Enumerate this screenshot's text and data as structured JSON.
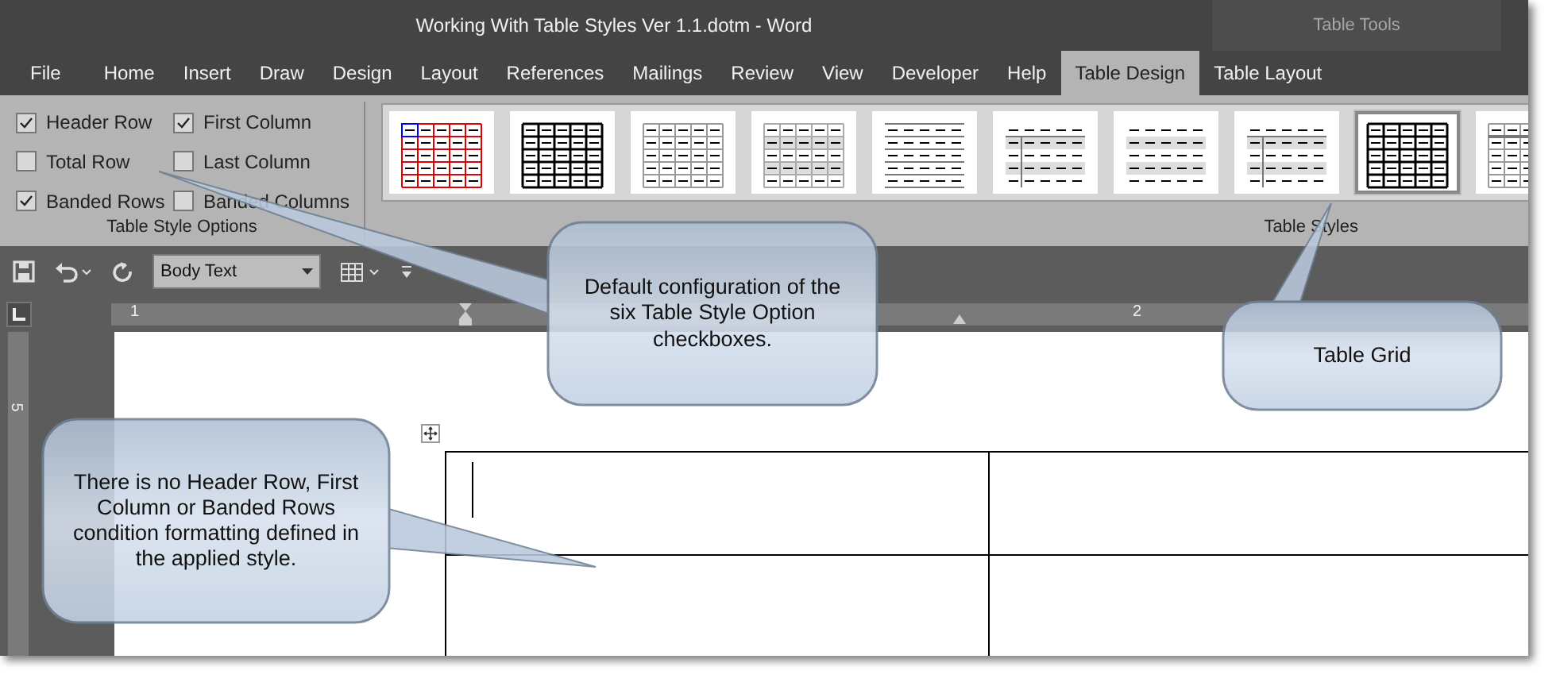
{
  "window": {
    "title": "Working With Table Styles Ver 1.1.dotm  -  Word",
    "context_label": "Table Tools"
  },
  "tabs": [
    {
      "label": "File",
      "selected": false
    },
    {
      "label": "Home",
      "selected": false
    },
    {
      "label": "Insert",
      "selected": false
    },
    {
      "label": "Draw",
      "selected": false
    },
    {
      "label": "Design",
      "selected": false
    },
    {
      "label": "Layout",
      "selected": false
    },
    {
      "label": "References",
      "selected": false
    },
    {
      "label": "Mailings",
      "selected": false
    },
    {
      "label": "Review",
      "selected": false
    },
    {
      "label": "View",
      "selected": false
    },
    {
      "label": "Developer",
      "selected": false
    },
    {
      "label": "Help",
      "selected": false
    },
    {
      "label": "Table Design",
      "selected": true
    },
    {
      "label": "Table Layout",
      "selected": false
    }
  ],
  "table_style_options": {
    "label": "Table Style Options",
    "items": [
      {
        "label": "Header Row",
        "checked": true
      },
      {
        "label": "First Column",
        "checked": true
      },
      {
        "label": "Total Row",
        "checked": false
      },
      {
        "label": "Last Column",
        "checked": false
      },
      {
        "label": "Banded Rows",
        "checked": true
      },
      {
        "label": "Banded Columns",
        "checked": false
      }
    ]
  },
  "table_styles": {
    "label": "Table Styles",
    "items": [
      {
        "kind": "red-grid",
        "selected": false
      },
      {
        "kind": "bold-grid",
        "selected": false
      },
      {
        "kind": "light-grid",
        "selected": false
      },
      {
        "kind": "shaded-grid",
        "selected": false
      },
      {
        "kind": "lines",
        "selected": false
      },
      {
        "kind": "first-column",
        "selected": false
      },
      {
        "kind": "banded",
        "selected": false
      },
      {
        "kind": "first-column",
        "selected": false
      },
      {
        "kind": "bold-grid",
        "selected": true
      },
      {
        "kind": "header-grid",
        "selected": false
      }
    ]
  },
  "quick_access": {
    "style_box": {
      "value": "Body Text"
    }
  },
  "ruler": {
    "labels": [
      "1",
      "2"
    ],
    "vertical_label": "5"
  },
  "callouts": [
    {
      "text": "Default configuration of the six Table Style Option checkboxes."
    },
    {
      "text": "Table Grid"
    },
    {
      "text": "There is no Header Row, First Column or Banded Rows condition formatting defined in the applied style."
    }
  ]
}
